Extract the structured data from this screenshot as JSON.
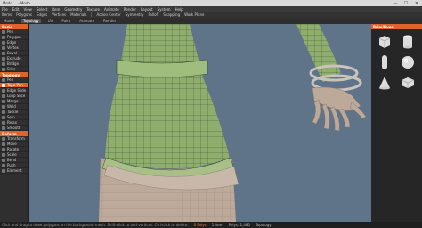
{
  "window": {
    "title": "Modo ... - Modo",
    "min": "—",
    "max": "☐",
    "close": "✕"
  },
  "menubar": [
    "File",
    "Edit",
    "View",
    "Select",
    "Item",
    "Geometry",
    "Texture",
    "Animate",
    "Render",
    "Layout",
    "System",
    "Help"
  ],
  "toolbar": [
    "Items",
    "Polygons",
    "Edges",
    "Vertices",
    "Materials",
    "Action Center",
    "Symmetry",
    "Falloff",
    "Snapping",
    "Work Plane"
  ],
  "tabs": [
    {
      "label": "Model",
      "active": false
    },
    {
      "label": "Topology",
      "active": true
    },
    {
      "label": "UV",
      "active": false
    },
    {
      "label": "Paint",
      "active": false
    },
    {
      "label": "Animate",
      "active": false
    },
    {
      "label": "Render",
      "active": false
    }
  ],
  "left_panel": {
    "sections": [
      {
        "title": "Basic",
        "tools": [
          "Pen",
          "Polygon",
          "Edge",
          "Vertex",
          "Bevel",
          "Extrude",
          "Bridge",
          "Slice"
        ]
      },
      {
        "title": "Topology",
        "tools": [
          "Pen",
          "Topo Pen",
          "Edge Slide",
          "Loop Slice",
          "Merge",
          "Weld",
          "Tackle",
          "Spin",
          "Relax",
          "Smooth"
        ]
      },
      {
        "title": "Deform",
        "tools": [
          "Transform",
          "Move",
          "Rotate",
          "Scale",
          "Bend",
          "Push",
          "Element"
        ]
      }
    ],
    "active_tool": "Topo Pen"
  },
  "right_panel": {
    "title": "Primitives",
    "shapes": [
      "cube",
      "cylinder",
      "capsule",
      "sphere",
      "cone",
      "box"
    ]
  },
  "status": {
    "hint": "Click and drag to draw polygons on the background mesh. Shift-click to add vertices. Ctrl-click to delete.",
    "selection": "0 Polys",
    "items": "1 Item",
    "polys": "Polys: 2,480",
    "mode": "Topology"
  },
  "colors": {
    "accent": "#e0632a",
    "viewport_bg": "#5f7389",
    "mesh_green": "#8fae6e",
    "mesh_skin": "#bca99a"
  }
}
